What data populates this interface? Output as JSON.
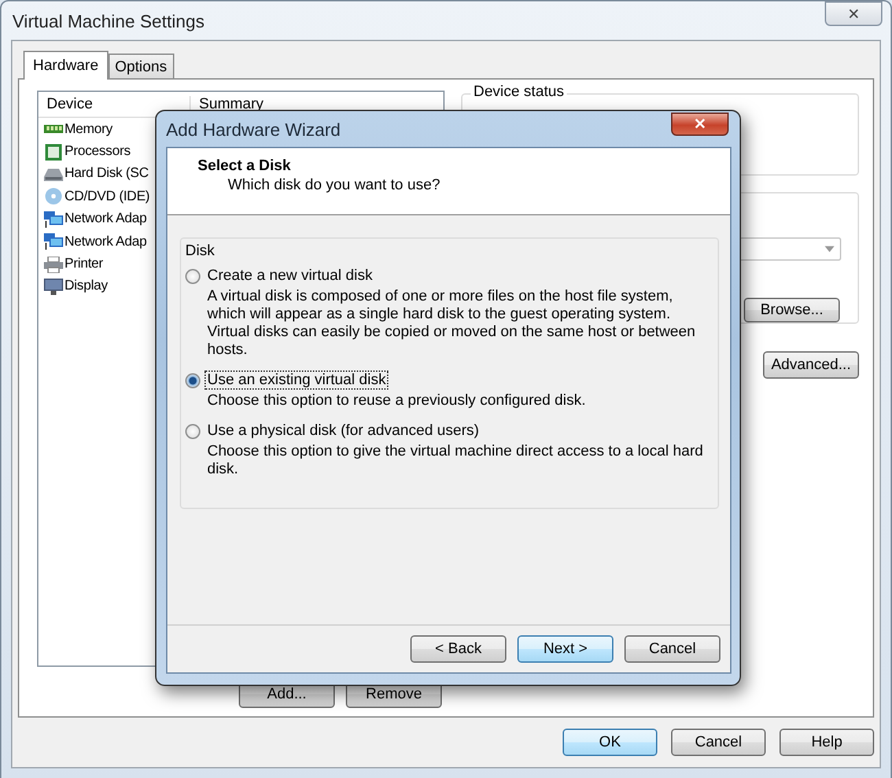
{
  "window": {
    "title": "Virtual Machine Settings",
    "close": "✕"
  },
  "tabs": [
    {
      "label": "Hardware",
      "selected": true
    },
    {
      "label": "Options",
      "selected": false
    }
  ],
  "device_list": {
    "columns": [
      "Device",
      "Summary"
    ],
    "items": [
      {
        "kind": "memory",
        "name": "Memory"
      },
      {
        "kind": "processor",
        "name": "Processors"
      },
      {
        "kind": "disk",
        "name": "Hard Disk (SC"
      },
      {
        "kind": "cd",
        "name": "CD/DVD (IDE)"
      },
      {
        "kind": "network",
        "name": "Network Adap"
      },
      {
        "kind": "network",
        "name": "Network Adap"
      },
      {
        "kind": "printer",
        "name": "Printer"
      },
      {
        "kind": "display",
        "name": "Display"
      }
    ],
    "buttons": [
      "Add...",
      "Remove"
    ]
  },
  "device_status": {
    "title": "Device status"
  },
  "side_buttons": [
    "Browse...",
    "Advanced..."
  ],
  "dialog_buttons": [
    {
      "label": "OK",
      "default": true
    },
    {
      "label": "Cancel",
      "default": false
    },
    {
      "label": "Help",
      "default": false
    }
  ],
  "wizard": {
    "title": "Add Hardware Wizard",
    "close": "✕",
    "heading": "Select a Disk",
    "subheading": "Which disk do you want to use?",
    "group": "Disk",
    "options": [
      {
        "label": "Create a new virtual disk",
        "description": "A virtual disk is composed of one or more files on the host file system, which will appear as a single hard disk to the guest operating system. Virtual disks can easily be copied or moved on the same host or between hosts.",
        "selected": false
      },
      {
        "label": "Use an existing virtual disk",
        "description": "Choose this option to reuse a previously configured disk.",
        "selected": true
      },
      {
        "label": "Use a physical disk (for advanced users)",
        "description": "Choose this option to give the virtual machine direct access to a local hard disk.",
        "selected": false
      }
    ],
    "buttons": [
      {
        "label": "< Back",
        "default": false
      },
      {
        "label": "Next >",
        "default": true
      },
      {
        "label": "Cancel",
        "default": false
      }
    ]
  }
}
